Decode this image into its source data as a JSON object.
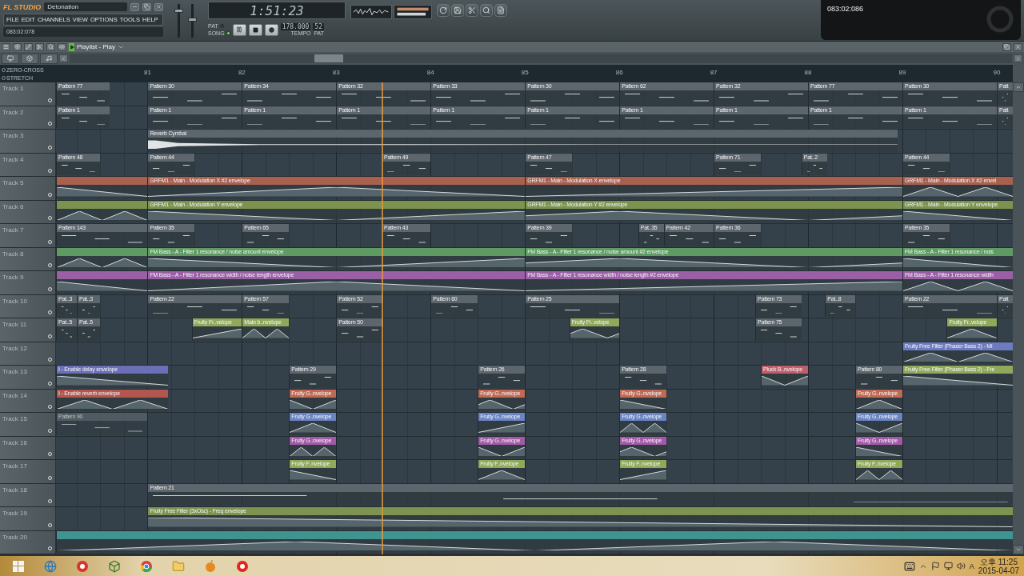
{
  "app": {
    "logo": "FL STUDIO",
    "project": "Detonation",
    "menu": [
      "FILE",
      "EDIT",
      "CHANNELS",
      "VIEW",
      "OPTIONS",
      "TOOLS",
      "HELP"
    ],
    "hint": "083:02:078"
  },
  "faders": [
    {
      "level": 0.8
    },
    {
      "level": 0.55
    }
  ],
  "transport": {
    "time": "1:51:23",
    "modes": [
      {
        "label": "PAT",
        "selected": false
      },
      {
        "label": "SONG",
        "selected": true
      }
    ],
    "tempo": "178.000",
    "tempo_label": "TEMPO",
    "pattern": "52",
    "pattern_label": "PAT"
  },
  "recording_timer": "083:02:086",
  "playlist": {
    "title": "Playlist - Play",
    "options": [
      {
        "label": "ZERO-CROSS",
        "checked": false
      },
      {
        "label": "STRETCH",
        "checked": false
      }
    ],
    "bars": [
      "81",
      "82",
      "83",
      "84",
      "85",
      "86",
      "87",
      "88",
      "89",
      "90"
    ],
    "tracks": [
      {
        "name": "Track 1",
        "clips": [
          {
            "kind": "pattern",
            "label": "Pattern 77"
          },
          {
            "kind": "pattern",
            "label": "Pattern 30"
          },
          {
            "kind": "pattern",
            "label": "Pattern 34"
          },
          {
            "kind": "pattern",
            "label": "Pattern 32"
          },
          {
            "kind": "pattern",
            "label": "Pattern 33"
          },
          {
            "kind": "pattern",
            "label": "Pattern 30"
          },
          {
            "kind": "pattern",
            "label": "Pattern 62"
          },
          {
            "kind": "pattern",
            "label": "Pattern 32"
          },
          {
            "kind": "pattern",
            "label": "Pattern 77"
          },
          {
            "kind": "pattern",
            "label": "Pattern 30"
          },
          {
            "kind": "pattern",
            "label": "Patt"
          }
        ]
      },
      {
        "name": "Track 2",
        "clips": [
          {
            "kind": "pattern",
            "label": "Pattern 1"
          },
          {
            "kind": "pattern",
            "label": "Pattern 1"
          },
          {
            "kind": "pattern",
            "label": "Pattern 1"
          },
          {
            "kind": "pattern",
            "label": "Pattern 1"
          },
          {
            "kind": "pattern",
            "label": "Pattern 1"
          },
          {
            "kind": "pattern",
            "label": "Pattern 1"
          },
          {
            "kind": "pattern",
            "label": "Pattern 1"
          },
          {
            "kind": "pattern",
            "label": "Pattern 1"
          },
          {
            "kind": "pattern",
            "label": "Pattern 1"
          },
          {
            "kind": "pattern",
            "label": "Pattern 1"
          },
          {
            "kind": "pattern",
            "label": "Patt"
          }
        ]
      },
      {
        "name": "Track 3",
        "clips": [
          {
            "kind": "audio",
            "label": "Reverb Cymbal"
          }
        ]
      },
      {
        "name": "Track 4",
        "clips": [
          {
            "kind": "pattern",
            "label": "Pattern 48"
          },
          {
            "kind": "pattern",
            "label": "Pattern 44"
          },
          {
            "kind": "pattern",
            "label": "Pattern 49"
          },
          {
            "kind": "pattern",
            "label": "Pattern 47"
          },
          {
            "kind": "pattern",
            "label": "Pattern 71"
          },
          {
            "kind": "pattern",
            "label": "Pat..2"
          },
          {
            "kind": "pattern",
            "label": "Pattern 44"
          }
        ]
      },
      {
        "name": "Track 5",
        "clips": [
          {
            "kind": "automation",
            "color": "#a8604f"
          },
          {
            "kind": "automation",
            "color": "#a8604f",
            "label": "GRFM1 - Main - Modulation X #2 envelope"
          },
          {
            "kind": "automation",
            "color": "#a8604f",
            "label": "GRFM1 - Main - Modulation X envelope"
          },
          {
            "kind": "automation",
            "color": "#a8604f",
            "label": "GRFM1 - Main - Modulation X #2 envel"
          }
        ]
      },
      {
        "name": "Track 6",
        "clips": [
          {
            "kind": "automation",
            "color": "#7c9350"
          },
          {
            "kind": "automation",
            "color": "#7c9350",
            "label": "GRFM1 - Main - Modulation Y envelope"
          },
          {
            "kind": "automation",
            "color": "#7c9350",
            "label": "GRFM1 - Main - Modulation Y #2 envelope"
          },
          {
            "kind": "automation",
            "color": "#7c9350",
            "label": "GRFM1 - Main - Modulation Y envelope"
          }
        ]
      },
      {
        "name": "Track 7",
        "clips": [
          {
            "kind": "pattern",
            "label": "Pattern 143"
          },
          {
            "kind": "pattern",
            "label": "Pattern 35"
          },
          {
            "kind": "pattern",
            "label": "Pattern 65"
          },
          {
            "kind": "pattern",
            "label": "Pattern 43"
          },
          {
            "kind": "pattern",
            "label": "Pattern 39"
          },
          {
            "kind": "pattern",
            "label": "Pat..35"
          },
          {
            "kind": "pattern",
            "label": "Pattern 42"
          },
          {
            "kind": "pattern",
            "label": "Pattern 36"
          },
          {
            "kind": "pattern",
            "label": "Pattern 35"
          }
        ]
      },
      {
        "name": "Track 8",
        "clips": [
          {
            "kind": "automation",
            "color": "#5f9a62"
          },
          {
            "kind": "automation",
            "color": "#5f9a62",
            "label": "FM Bass - A - Filter 1 resonance / noise amount envelope"
          },
          {
            "kind": "automation",
            "color": "#5f9a62",
            "label": "FM Bass - A - Filter 1 resonance / noise amount #2 envelope"
          },
          {
            "kind": "automation",
            "color": "#5f9a62",
            "label": "FM Bass - A - Filter 1 resonance / nois"
          }
        ]
      },
      {
        "name": "Track 9",
        "clips": [
          {
            "kind": "automation",
            "color": "#9b5fa6"
          },
          {
            "kind": "automation",
            "color": "#9b5fa6",
            "label": "FM Bass - A - Filter 1 resonance width / noise length envelope"
          },
          {
            "kind": "automation",
            "color": "#9b5fa6",
            "label": "FM Bass - A - Filter 1 resonance width / noise length #2 envelope"
          },
          {
            "kind": "automation",
            "color": "#9b5fa6",
            "label": "FM Bass - A - Filter 1 resonance width"
          }
        ]
      },
      {
        "name": "Track 10",
        "clips": [
          {
            "kind": "pattern",
            "label": "Pat..3"
          },
          {
            "kind": "pattern",
            "label": "Pat..3"
          },
          {
            "kind": "pattern",
            "label": "Pattern 22"
          },
          {
            "kind": "pattern",
            "label": "Pattern 57"
          },
          {
            "kind": "pattern",
            "label": "Pattern 52"
          },
          {
            "kind": "pattern",
            "label": "Pattern 60"
          },
          {
            "kind": "pattern",
            "label": "Pattern 25"
          },
          {
            "kind": "pattern",
            "label": "Pattern 73"
          },
          {
            "kind": "pattern",
            "label": "Pat..8"
          },
          {
            "kind": "pattern",
            "label": "Pattern 22"
          },
          {
            "kind": "pattern",
            "label": "Patt"
          }
        ]
      },
      {
        "name": "Track 11",
        "clips": [
          {
            "kind": "pattern",
            "label": "Pat..5"
          },
          {
            "kind": "pattern",
            "label": "Pat..5"
          },
          {
            "kind": "automation",
            "color": "#8fa85a",
            "label": "Fruity Fr..velope"
          },
          {
            "kind": "automation",
            "color": "#8fa85a",
            "label": "Main b..nvelope"
          },
          {
            "kind": "pattern",
            "label": "Pattern 50"
          },
          {
            "kind": "automation",
            "color": "#8fa85a",
            "label": "Fruity Fr..velope"
          },
          {
            "kind": "pattern",
            "label": "Pattern 75"
          },
          {
            "kind": "automation",
            "color": "#8fa85a",
            "label": "Fruity Fr..velope"
          }
        ]
      },
      {
        "name": "Track 12",
        "clips": [
          {
            "kind": "automation",
            "color": "#6d7bc0",
            "label": "Fruity Free Filter (Phaser Bass 2) - Mi"
          }
        ]
      },
      {
        "name": "Track 13",
        "clips": [
          {
            "kind": "automation",
            "color": "#6b6fb5",
            "label": "I - Enable delay envelope"
          },
          {
            "kind": "pattern",
            "label": "Pattern 29"
          },
          {
            "kind": "pattern",
            "label": "Pattern 26"
          },
          {
            "kind": "pattern",
            "label": "Pattern 28"
          },
          {
            "kind": "automation",
            "color": "#c05f6b",
            "label": "Pluck B..nvelope"
          },
          {
            "kind": "pattern",
            "label": "Pattern 80"
          },
          {
            "kind": "automation",
            "color": "#8fa85a",
            "label": "Fruity Free Filter (Phaser Bass 2) - Fre"
          }
        ]
      },
      {
        "name": "Track 14",
        "clips": [
          {
            "kind": "automation",
            "color": "#b2574f",
            "label": "I - Enable reverb envelope"
          },
          {
            "kind": "automation",
            "color": "#c06a55",
            "label": "Fruity G..nvelope"
          },
          {
            "kind": "automation",
            "color": "#c06a55",
            "label": "Fruity G..nvelope"
          },
          {
            "kind": "automation",
            "color": "#c06a55",
            "label": "Fruity G..nvelope"
          },
          {
            "kind": "automation",
            "color": "#c06a55",
            "label": "Fruity G..nvelope"
          }
        ]
      },
      {
        "name": "Track 15",
        "clips": [
          {
            "kind": "pattern",
            "label": "Pattern 90",
            "muted": true
          },
          {
            "kind": "automation",
            "color": "#6a84c4",
            "label": "Fruity G..nvelope"
          },
          {
            "kind": "automation",
            "color": "#6a84c4",
            "label": "Fruity G..nvelope"
          },
          {
            "kind": "automation",
            "color": "#6a84c4",
            "label": "Fruity G..nvelope"
          },
          {
            "kind": "automation",
            "color": "#6a84c4",
            "label": "Fruity G..nvelope"
          }
        ]
      },
      {
        "name": "Track 16",
        "clips": [
          {
            "kind": "automation",
            "color": "#a25aa8",
            "label": "Fruity G..nvelope"
          },
          {
            "kind": "automation",
            "color": "#a25aa8",
            "label": "Fruity G..nvelope"
          },
          {
            "kind": "automation",
            "color": "#a25aa8",
            "label": "Fruity G..nvelope"
          },
          {
            "kind": "automation",
            "color": "#a25aa8",
            "label": "Fruity G..nvelope"
          }
        ]
      },
      {
        "name": "Track 17",
        "clips": [
          {
            "kind": "automation",
            "color": "#8fa85a",
            "label": "Fruity F..nvelope"
          },
          {
            "kind": "automation",
            "color": "#8fa85a",
            "label": "Fruity F..nvelope"
          },
          {
            "kind": "automation",
            "color": "#8fa85a",
            "label": "Fruity F..nvelope"
          },
          {
            "kind": "automation",
            "color": "#8fa85a",
            "label": "Fruity F..nvelope"
          }
        ]
      },
      {
        "name": "Track 18",
        "clips": [
          {
            "kind": "pattern",
            "label": "Pattern 21"
          }
        ]
      },
      {
        "name": "Track 19",
        "clips": [
          {
            "kind": "automation",
            "color": "#7f9350",
            "label": "Fruity Free Filter (3xOsc) - Freq envelope"
          }
        ]
      },
      {
        "name": "Track 20",
        "clips": [
          {
            "kind": "automation",
            "color": "#3f9490"
          }
        ]
      }
    ]
  },
  "taskbar": {
    "ime": "A",
    "time": "오후 11:25",
    "date": "2015-04-07"
  }
}
